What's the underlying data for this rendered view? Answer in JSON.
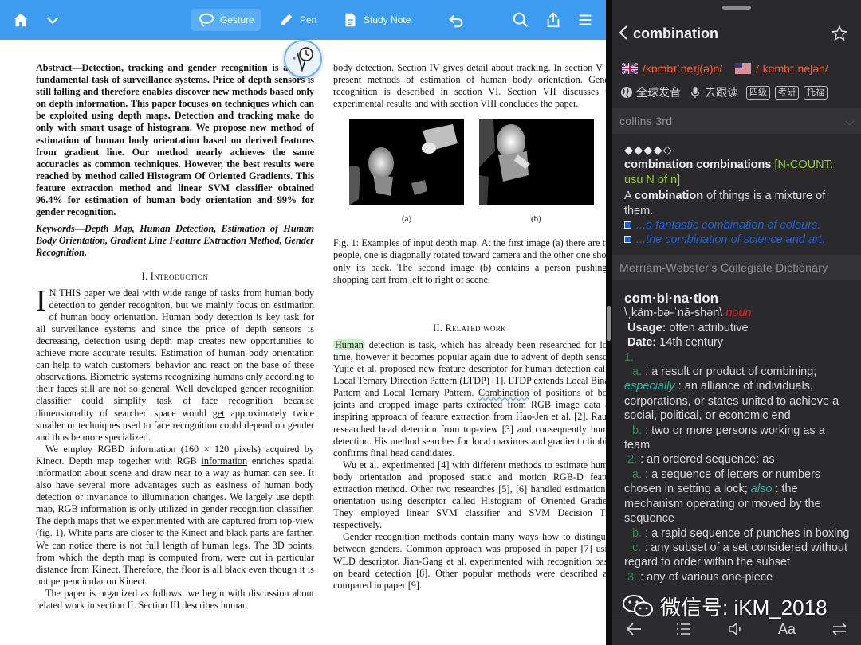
{
  "toolbar": {
    "tools": [
      "Gesture",
      "Pen",
      "Study Note"
    ],
    "accent": "#3d9bf0"
  },
  "paper": {
    "abstract": "Abstract—Detection, tracking and gender recognition is a come fundamental task of surveillance systems. Price of depth sensors is still falling and therefore enables discover new methods based only on depth information. This paper focuses on techniques which can be exploited using depth maps. Detection and tracking make do only with smart usage of histogram. We propose new method of estimation of human body orientation based on derived features from gradient line. Our method nearly achieves the same accuracies as common techniques. However, the best results were reached by method called Histogram Of Oriented Gradients. This feature extraction method and linear SVM classifier obtained 96.4% for estimation of human body orientation and 99% for gender recognition.",
    "keywords": "Keywords—Depth Map, Human Detection, Estimation of Human Body Orientation, Gradient Line Feature Extraction Method, Gender Recognition.",
    "sec1_title": "I. Introduction",
    "sec1_dropcap": "I",
    "sec1_p1a": "N THIS paper we deal with wide range of tasks from human body detection to gender recogniton, but we mainly focus on estimation of human body orientation. Human body detection is key task for all surveillance systems and since the price of depth sensors is decreasing, detection using depth map creates new opportunities to achieve more accurate results. Estimation of human body orientation can help to watch customers' behavior and react on the base of these observations. Biometric systems recognizing humans only according to their faces still are not so general. Well developed gender recognition classifier could simplify task of face",
    "sec1_ul1": "recognition",
    "sec1_p1b": "because dimensionality of searched space would",
    "sec1_ul2": "get",
    "sec1_p1c": "approximately twice smaller or techniques used to face recognition could depend on gender and thus be more specialized.",
    "sec1_p2a": "We employ RGBD information (160 × 120 pixels) acquired by Kinect. Depth map together with RGB",
    "sec1_ul3": "information",
    "sec1_p2b": "enriches spatial information about scene and draw near to a way as human can see. It also have several more advantages such as easiness of human body detection or invariance to illumination changes. We largely use depth map, RGB information is only utilized in gender recognition classifier. The depth maps that we experimented with are captured from top-view (fig. 1). White parts are closer to the Kinect and black parts are farther. We can notice there is not full length of human legs. The 3D points, from which the depth map is computed from, were cut in particular distance from Kinect. Therefore, the floor is all black even though it is not perpendicular on Kinect.",
    "sec1_p3": "The paper is organized as follows: we begin with discussion about related work in section II. Section III describes human",
    "col2_p0": "body detection. Section IV gives detail about tracking. In section V we present methods of estimation of human body orientation. Gender recognition is described in section VI. Section VII discusses the experimental results and with section VIII concludes the paper.",
    "fig_a": "(a)",
    "fig_b": "(b)",
    "fig_caption": "Fig. 1: Examples of input depth map. At the first image (a) there are two people, one is diagonally rotated toward camera and the other one shows only its back. The second image (b) contains a person pushing a shopping cart from left to right of scene.",
    "sec2_title": "II. Related work",
    "sec2_hl": "Human",
    "sec2_p1a": "detection is task, which has already been researched for long time, however it becomes popular again due to advent of depth sensors. Yujie et al. proposed new feature descriptor for human detection called Local Ternary Direction Pattern (LTDP) [1]. LTDP extends Local Binary Pattern and Local Ternary Pattern.",
    "sec2_ul": "Combination",
    "sec2_p1b": "of positions of body joints and cropped image parts extracted from RGB image data are inspiring approach of feature extraction from Hao-Jen et al. [2]. Rauter researched head detection from top-view [3] and consequently human detection. His method searches for local maximas and gradient climbing confirms final head candidates.",
    "sec2_p2": "Wu et al. experimented [4] with different methods to estimate human body orientation and proposed static and motion RGB-D feature extraction method. Other two researches [5], [6] handled estimation of orientation using descriptor called Histogram of Oriented Gradient. They employed linear SVM classifier and SVM Decision Tree respectively.",
    "sec2_p3": "Gender recognition methods contain many ways how to distinguish between genders. Common approach was proposed in paper [7] using WLD descriptor. Jian-Gang et al. experimented with recognition based on beard detection [8]. Other popular methods were described and compared in paper [9]."
  },
  "dict": {
    "word": "combination",
    "uk_ipa": "/kɒmbɪˈneɪʃ(ə)n/",
    "us_ipa": "/ˌkɑmbɪˈneʃən/",
    "audio_global": "全球发音",
    "audio_follow": "去跟读",
    "tags": [
      "四级",
      "考研",
      "托福"
    ],
    "collins": {
      "header": "collins 3rd",
      "stars": "◆◆◆◆◇",
      "headword": "combination combinations",
      "grammar": "[N-COUNT: usu N of n]",
      "def_a": "A",
      "def_bold": "combination",
      "def_b": "of things is a mixture of them.",
      "ex1": "...a fantastic combination of colours.",
      "ex2": "...the combination of science and art."
    },
    "mw": {
      "header": "Merriam-Webster's Collegiate Dictionary",
      "headword": "com·bi·na·tion",
      "pron": "\\ˌkäm-bə-ˈnā-shən\\",
      "pos": "noun",
      "usage_label": "Usage:",
      "usage": "often attributive",
      "date_label": "Date:",
      "date": "14th century",
      "n1": "1.",
      "s1a_l": "a.",
      "s1a": ": a result or product of combining;",
      "s1a_esp": "especially",
      "s1a_b": ": an alliance of individuals, corporations, or states united to achieve a social, political, or economic end",
      "s1b_l": "b.",
      "s1b": ": two or more persons working as a team",
      "n2": "2.",
      "s2": ": an ordered sequence: as",
      "s2a_l": "a.",
      "s2a": ": a sequence of letters or numbers chosen in setting a lock;",
      "s2a_also": "also",
      "s2a_b": ": the mechanism operating or moved by the sequence",
      "s2b_l": "b.",
      "s2b": ": a rapid sequence of punches in boxing",
      "s2c_l": "c.",
      "s2c": ": any subset of a set considered without regard to order within the subset",
      "n3": "3.",
      "s3": ": any of various one-piece"
    },
    "bottom": {
      "font_label": "Aa"
    }
  },
  "watermark": "微信号: iKM_2018"
}
